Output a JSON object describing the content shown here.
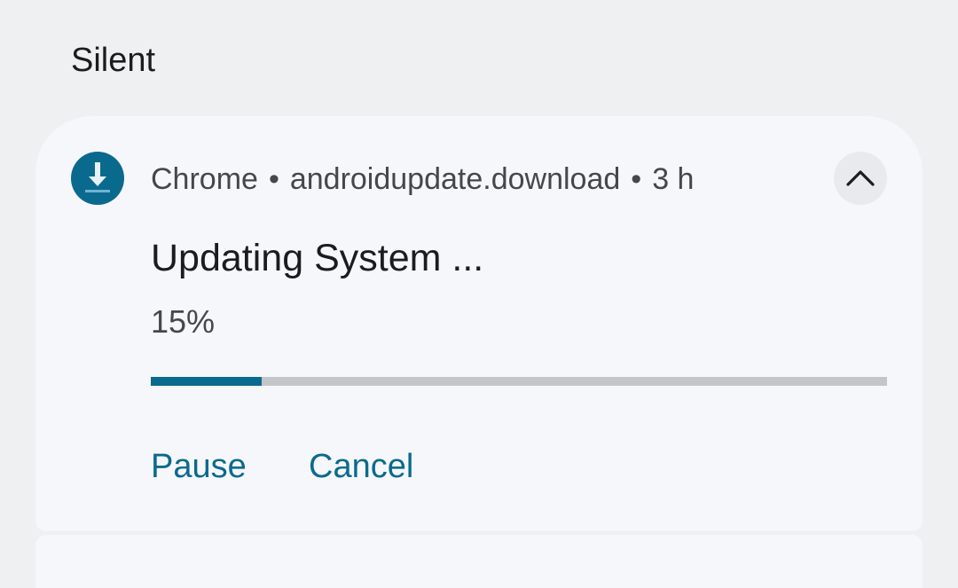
{
  "section": {
    "title": "Silent"
  },
  "notification": {
    "app_icon": "download-icon",
    "app_name": "Chrome",
    "separator": "•",
    "source": "androidupdate.download",
    "time": "3 h",
    "expand_icon": "chevron-up-icon",
    "title": "Updating System ...",
    "progress_text": "15%",
    "progress_value": 0.15,
    "actions": {
      "pause": "Pause",
      "cancel": "Cancel"
    }
  },
  "colors": {
    "accent": "#0a6a8e",
    "background": "#eff0f2",
    "card": "#f6f7fb",
    "track": "#c3c5c9"
  }
}
